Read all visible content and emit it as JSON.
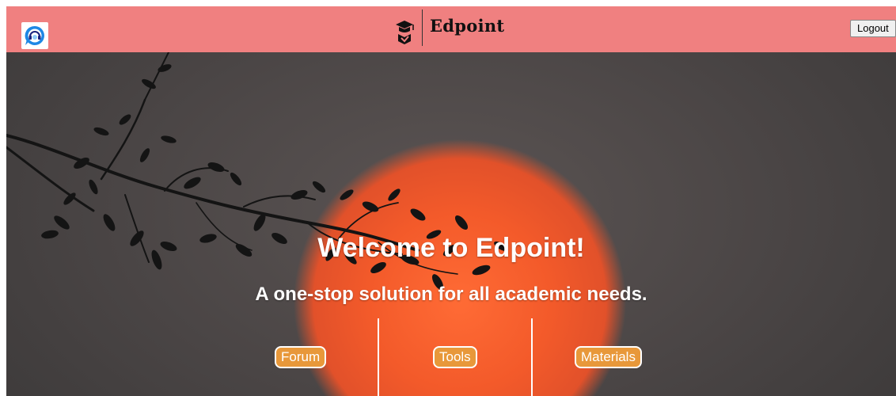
{
  "header": {
    "brand_name": "Edpoint",
    "support_icon": "headset-chat-icon",
    "brand_icon": "graduation-cap-icon",
    "logout_label": "Logout",
    "background_color": "#f08080"
  },
  "hero": {
    "title": "Welcome to Edpoint!",
    "subtitle": "A one-stop solution for all academic needs.",
    "nav": [
      {
        "label": "Forum"
      },
      {
        "label": "Tools"
      },
      {
        "label": "Materials"
      }
    ],
    "button_color": "#e8983a"
  }
}
